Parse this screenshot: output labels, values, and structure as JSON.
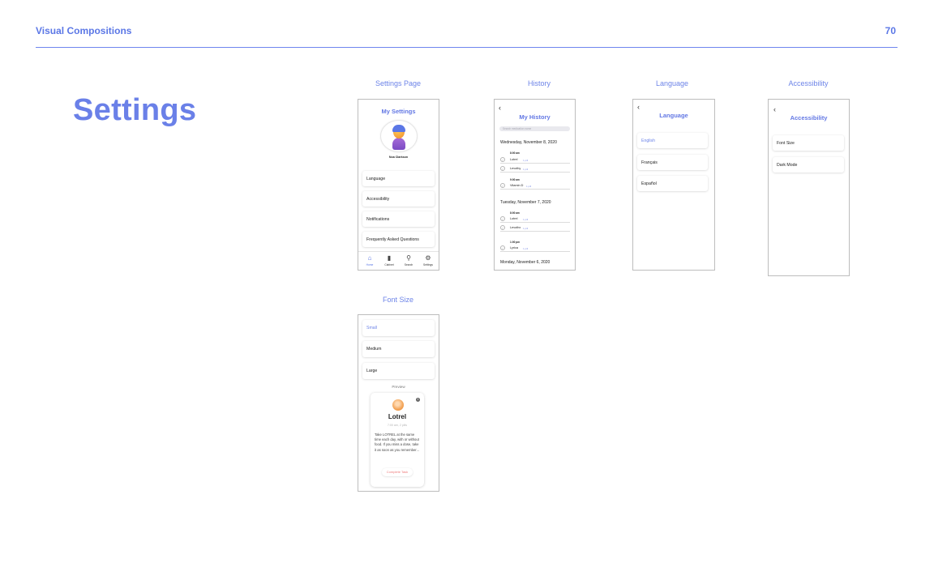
{
  "header": {
    "section_title": "Visual Compositions",
    "page_number": "70"
  },
  "slide_title": "Settings",
  "screens": {
    "settings": {
      "caption": "Settings Page",
      "title": "My Settings",
      "user_name": "Noa Clarkson",
      "items": [
        "Language",
        "Accessibility",
        "Notifications",
        "Frequently Asked Questions"
      ],
      "tabs": [
        {
          "icon": "home-icon",
          "label": "Home"
        },
        {
          "icon": "cabinet-icon",
          "label": "Cabinet"
        },
        {
          "icon": "search-icon",
          "label": "Search"
        },
        {
          "icon": "gear-icon",
          "label": "Settings"
        }
      ]
    },
    "history": {
      "caption": "History",
      "back": "‹",
      "title": "My History",
      "search_placeholder": "Search medication name",
      "groups": [
        {
          "date": "Wednesday, November 8, 2020",
          "entries": [
            {
              "time": "8:00 am",
              "meds": [
                {
                  "name": "Lotrel",
                  "qty": "1 pill"
                },
                {
                  "name": "Levothy",
                  "qty": "1 pill"
                }
              ]
            },
            {
              "time": "9:00 am",
              "meds": [
                {
                  "name": "Vitamin D",
                  "qty": "1 pill"
                }
              ]
            }
          ]
        },
        {
          "date": "Tuesday, November 7, 2020",
          "entries": [
            {
              "time": "8:00 am",
              "meds": [
                {
                  "name": "Lotrel",
                  "qty": "1 pill"
                },
                {
                  "name": "Levothx",
                  "qty": "1 pill"
                }
              ]
            },
            {
              "time": "1:00 pm",
              "meds": [
                {
                  "name": "Lyrica",
                  "qty": "1 pill"
                }
              ]
            }
          ]
        },
        {
          "date": "Monday, November 6, 2020",
          "entries": []
        }
      ]
    },
    "language": {
      "caption": "Language",
      "back": "‹",
      "title": "Language",
      "options": [
        "English",
        "Français",
        "Español"
      ],
      "selected": "English"
    },
    "accessibility": {
      "caption": "Accessibility",
      "back": "‹",
      "title": "Accessibility",
      "options": [
        "Font Size",
        "Dark Mode"
      ]
    },
    "font_size": {
      "caption": "Font Size",
      "options": [
        "Small",
        "Medium",
        "Large"
      ],
      "selected": "Small",
      "preview_label": "Preview",
      "card": {
        "name": "Lotrel",
        "info_icon": "i",
        "schedule": "7:00 am, 2 pills",
        "body": "Take LOTREL at the same time each day, with or without food. If you miss a dose, take it as soon as you remember...",
        "button": "Complete Task"
      }
    }
  },
  "colors": {
    "accent": "#5b77e6",
    "selected": "#6d84e8",
    "danger": "#ef7b7b"
  }
}
